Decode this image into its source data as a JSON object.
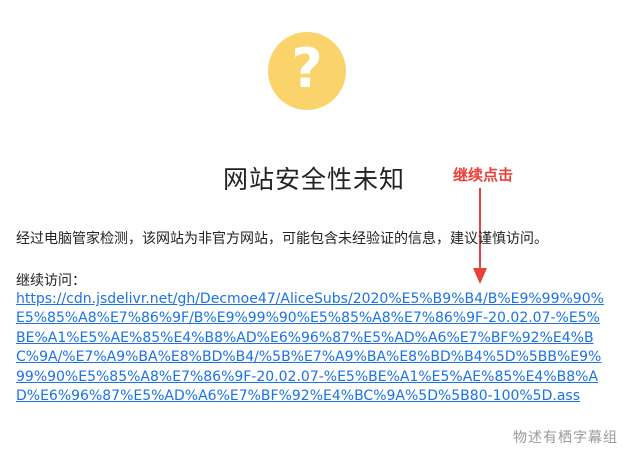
{
  "icon": {
    "glyph": "?",
    "name": "question-icon",
    "color": "#fbd36b"
  },
  "title": "网站安全性未知",
  "annotation": {
    "label": "继续点击",
    "color": "#e8403a"
  },
  "description": "经过电脑管家检测，该网站为非官方网站，可能包含未经验证的信息，建议谨慎访问。",
  "continue_label": "继续访问：",
  "link": {
    "url": "https://cdn.jsdelivr.net/gh/Decmoe47/AliceSubs/2020%E5%B9%B4/B%E9%99%90%E5%85%A8%E7%86%9F/B%E9%99%90%E5%85%A8%E7%86%9F-20.02.07-%E5%BE%A1%E5%AE%85%E4%B8%AD%E6%96%87%E5%AD%A6%E7%BF%92%E4%BC%9A/%E7%A9%BA%E8%BD%B4/%5B%E7%A9%BA%E8%BD%B4%5D%5BB%E9%99%90%E5%85%A8%E7%86%9F-20.02.07-%E5%BE%A1%E5%AE%85%E4%B8%AD%E6%96%87%E5%AD%A6%E7%BF%92%E4%BC%9A%5D%5B80-100%5D.ass",
    "color": "#1a73e8"
  },
  "watermark": "物述有栖字幕组"
}
